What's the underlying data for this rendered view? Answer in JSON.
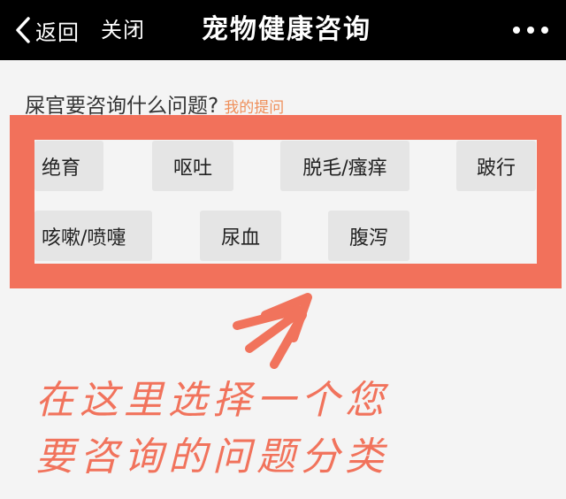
{
  "navbar": {
    "back_label": "返回",
    "close_label": "关闭",
    "title": "宠物健康咨询"
  },
  "prompt": {
    "question": "屎官要咨询什么问题?",
    "my_questions_link": "我的提问"
  },
  "categories": [
    {
      "label": "绝育"
    },
    {
      "label": "呕吐"
    },
    {
      "label": "脱毛/瘙痒"
    },
    {
      "label": "跛行"
    },
    {
      "label": "咳嗽/喷嚏"
    },
    {
      "label": "尿血"
    },
    {
      "label": "腹泻"
    }
  ],
  "annotation": {
    "line1": "在这里选择一个您",
    "line2": "要咨询的问题分类"
  },
  "colors": {
    "navbar_bg": "#000000",
    "highlight": "#f2715b",
    "link": "#ef8f5a",
    "button_bg": "#e5e5e5",
    "page_bg": "#f4f4f4"
  },
  "icons": {
    "back": "chevron-left-icon",
    "more": "more-dots-icon",
    "arrow": "annotation-arrow-icon"
  }
}
